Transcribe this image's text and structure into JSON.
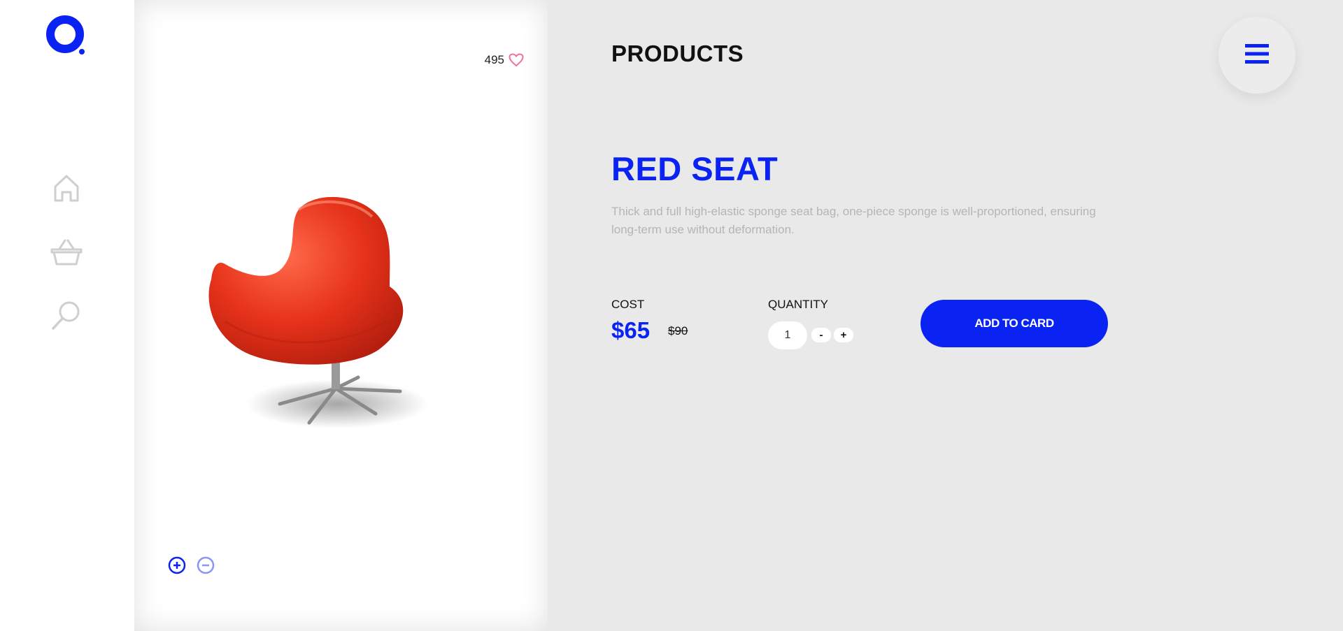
{
  "colors": {
    "accent": "#0a22f2",
    "heart": "#f06fa0",
    "icon_gray": "#cfcfcf"
  },
  "sidebar": {
    "logo_icon": "ring-logo-icon",
    "items": [
      {
        "icon": "home-icon"
      },
      {
        "icon": "basket-icon"
      },
      {
        "icon": "search-icon"
      }
    ]
  },
  "image_panel": {
    "likes_count": "495",
    "like_icon": "heart-icon",
    "zoom_in_icon": "zoom-in-icon",
    "zoom_out_icon": "zoom-out-icon"
  },
  "header": {
    "title": "PRODUCTS",
    "menu_icon": "hamburger-menu-icon"
  },
  "product": {
    "name": "RED SEAT",
    "description": "Thick and full high-elastic sponge seat bag, one-piece sponge is well-proportioned, ensuring long-term use without deformation.",
    "cost_label": "COST",
    "price": "$65",
    "old_price": "$90",
    "quantity_label": "QUANTITY",
    "quantity_value": "1",
    "minus_label": "-",
    "plus_label": "+",
    "add_button_label": "ADD TO CARD"
  }
}
